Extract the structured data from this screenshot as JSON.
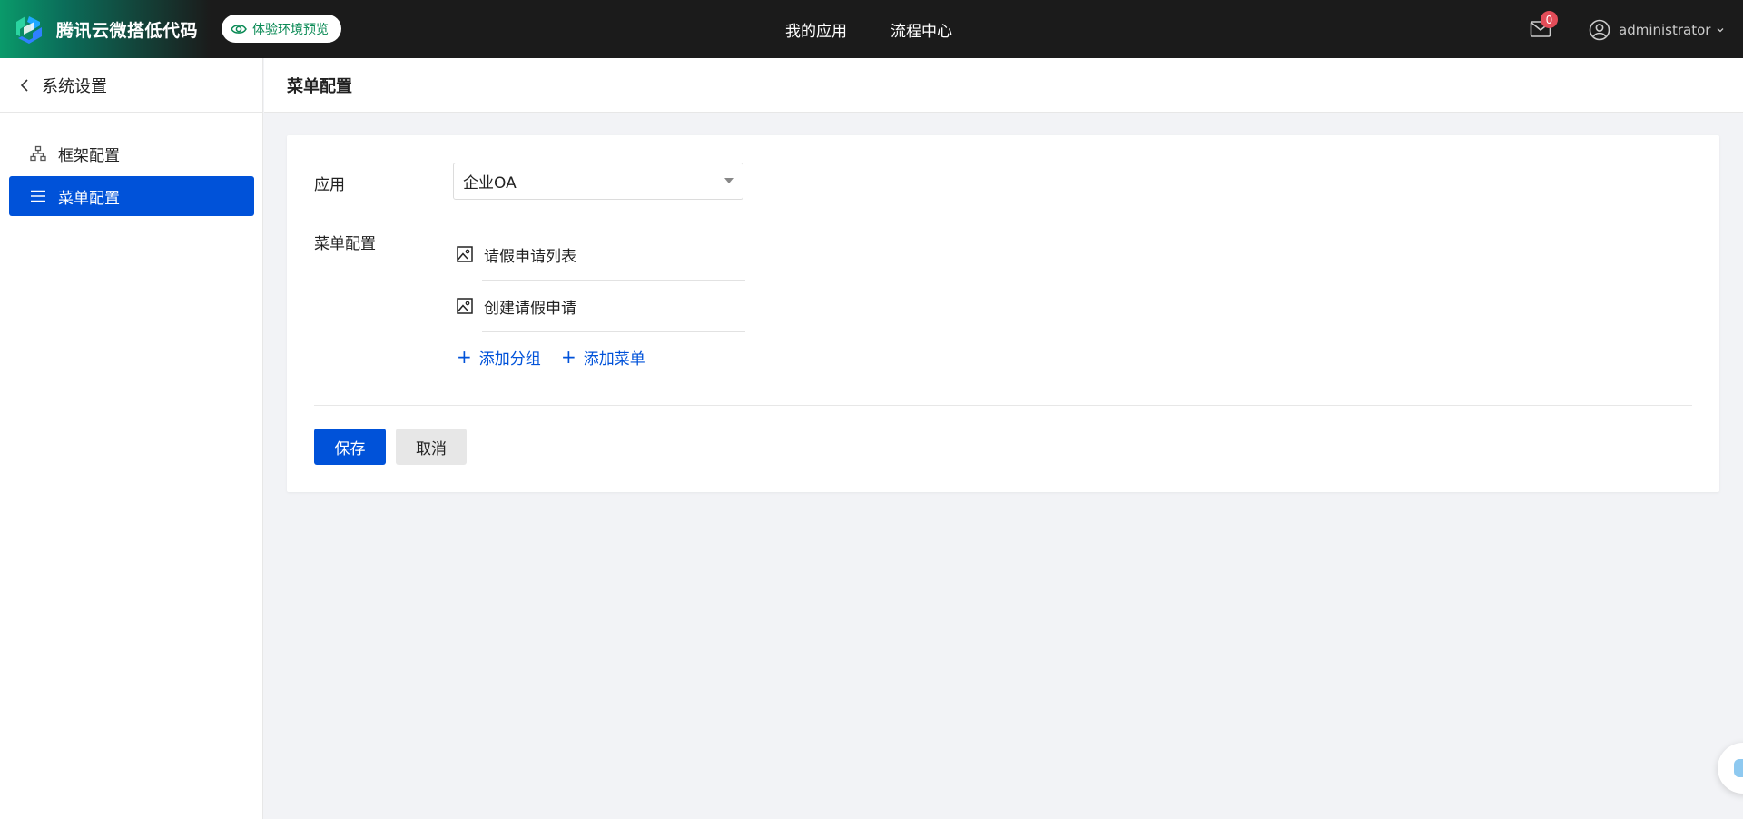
{
  "app": {
    "brand_name": "腾讯云微搭低代码",
    "preview_badge": "体验环境预览"
  },
  "nav": {
    "items": [
      {
        "label": "我的应用"
      },
      {
        "label": "流程中心"
      }
    ]
  },
  "header": {
    "mail_count": "0",
    "username": "administrator"
  },
  "sidebar": {
    "back_label": "系统设置",
    "items": [
      {
        "label": "框架配置",
        "icon": "sitemap-icon",
        "active": false
      },
      {
        "label": "菜单配置",
        "icon": "list-icon",
        "active": true
      }
    ]
  },
  "page": {
    "title": "菜单配置"
  },
  "form": {
    "app_label": "应用",
    "app_value": "企业OA",
    "menu_label": "菜单配置",
    "menu_items": [
      {
        "label": "请假申请列表",
        "icon": "image-icon"
      },
      {
        "label": "创建请假申请",
        "icon": "image-icon"
      }
    ],
    "add_group": "添加分组",
    "add_menu": "添加菜单",
    "save": "保存",
    "cancel": "取消"
  },
  "colors": {
    "primary": "#0052d9",
    "topbar": "#1b1b1b",
    "brand_green": "#0a9a6a",
    "badge_red": "#e34d59"
  }
}
